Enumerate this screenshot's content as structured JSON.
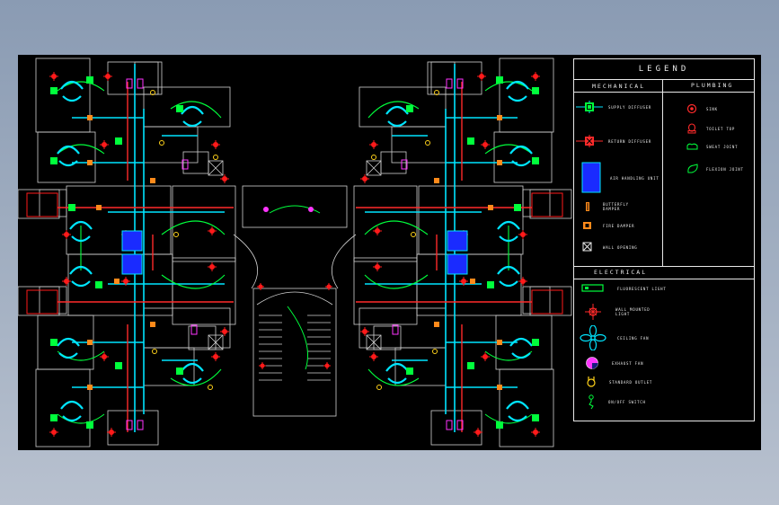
{
  "legend": {
    "title": "LEGEND",
    "mechanical": {
      "heading": "MECHANICAL",
      "items": [
        {
          "icon": "supply-diffuser-icon",
          "label": "SUPPLY DIFFUSER"
        },
        {
          "icon": "return-diffuser-icon",
          "label": "RETURN DIFFUSER"
        },
        {
          "icon": "air-handling-unit-icon",
          "label": "AIR HANDLING UNIT"
        },
        {
          "icon": "butterfly-damper-icon",
          "label": "BUTTERFLY DAMPER"
        },
        {
          "icon": "fire-damper-icon",
          "label": "FIRE DAMPER"
        },
        {
          "icon": "wall-opening-icon",
          "label": "WALL OPENING"
        }
      ]
    },
    "plumbing": {
      "heading": "PLUMBING",
      "items": [
        {
          "icon": "sink-icon",
          "label": "SINK"
        },
        {
          "icon": "toilet-icon",
          "label": "TOILET TOP"
        },
        {
          "icon": "sweat-joint-icon",
          "label": "SWEAT JOINT"
        },
        {
          "icon": "flexion-joint-icon",
          "label": "FLEXION JOINT"
        }
      ]
    },
    "electrical": {
      "heading": "ELECTRICAL",
      "items": [
        {
          "icon": "fluorescent-light-icon",
          "label": "FLUORESCENT LIGHT"
        },
        {
          "icon": "wall-mounted-light-icon",
          "label": "WALL MOUNTED LIGHT"
        },
        {
          "icon": "ceiling-fan-icon",
          "label": "CEILING FAN"
        },
        {
          "icon": "exhaust-fan-icon",
          "label": "EXHAUST FAN"
        },
        {
          "icon": "standard-outlet-icon",
          "label": "STANDARD OUTLET"
        },
        {
          "icon": "switch-icon",
          "label": "ON/OFF SWITCH"
        }
      ]
    }
  },
  "colors": {
    "background": "#000000",
    "wall": "#d0d0d0",
    "supply_duct": "#00e5ff",
    "return_duct": "#ff2a2a",
    "fixture_green": "#00ff3c",
    "light_red": "#ff1a1a",
    "ahu_blue": "#1a2bff",
    "outlet_yellow": "#ffd21a",
    "exhaust_magenta": "#ff35ff",
    "damper_orange": "#ff8a1a"
  }
}
